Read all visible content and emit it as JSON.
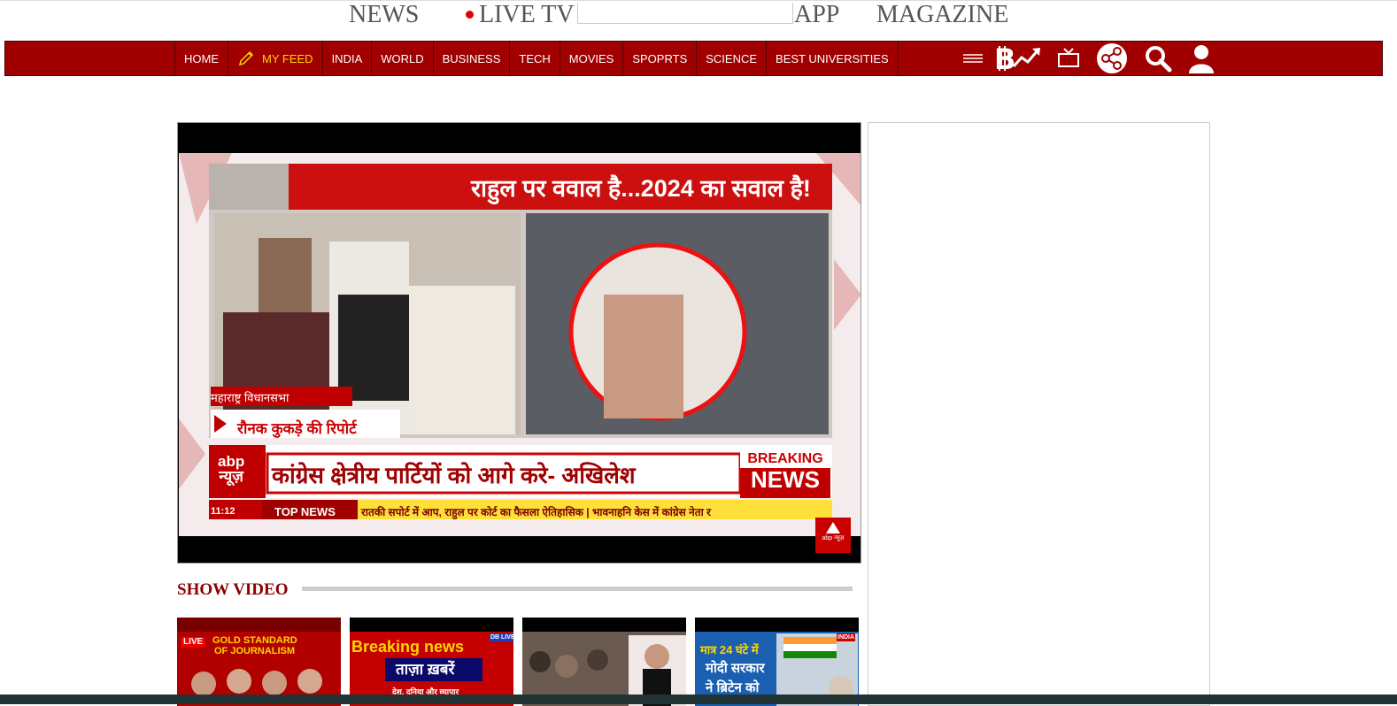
{
  "top_links": {
    "news": "NEWS",
    "live_tv": "LIVE TV",
    "app": "APP",
    "magazine": "MAGAZINE"
  },
  "nav": {
    "items": [
      "HOME",
      "MY FEED",
      "INDIA",
      "WORLD",
      "BUSINESS",
      "TECH",
      "MOVIES",
      "SPOPRTS",
      "SCIENCE",
      "BEST UNIVERSITIES"
    ],
    "icons": [
      "menu-icon",
      "bitcoin-trend-icon",
      "tv-icon",
      "share-icon",
      "search-icon",
      "user-icon"
    ]
  },
  "video": {
    "headline": "राहुल पर ववाल है...2024 का सवाल है!",
    "lower_third": "कांग्रेस क्षेत्रीय पार्टियों को आगे करे- अखिलेश",
    "breaking_top": "BREAKING",
    "breaking_bottom": "NEWS",
    "reporter": "रौनक कुकड़े की रिपोर्ट",
    "place": "महाराष्ट्र विधानसभा",
    "channel_line1": "abp",
    "channel_line2": "न्यूज़",
    "ticker_time": "11:12",
    "ticker_label": "TOP NEWS",
    "ticker_text": "रातकी सपोर्ट में आप, राहुल पर कोर्ट का फैसला ऐतिहासिक   |   भावनाहनि केस में कांग्रेस नेता र",
    "badge": "abp न्यूज़"
  },
  "section": {
    "title": "SHOW VIDEO"
  },
  "thumbnails": [
    {
      "line1": "GOLD STANDARD",
      "line2": "OF JOURNALISM",
      "tag": "LIVE"
    },
    {
      "line1": "Breaking news",
      "line2": "ताज़ा ख़बरें",
      "line3": "देश, दुनिया और व्यापार",
      "tag": "DB LIVE"
    },
    {
      "line1": ""
    },
    {
      "line1": "मात्र 24 घंटे में",
      "line2": "मोदी सरकार",
      "line3": "ने ब्रिटेन को",
      "tag": "INDIA"
    }
  ],
  "colors": {
    "brand_red": "#a00000",
    "myfeed_yellow": "#ffd400"
  }
}
